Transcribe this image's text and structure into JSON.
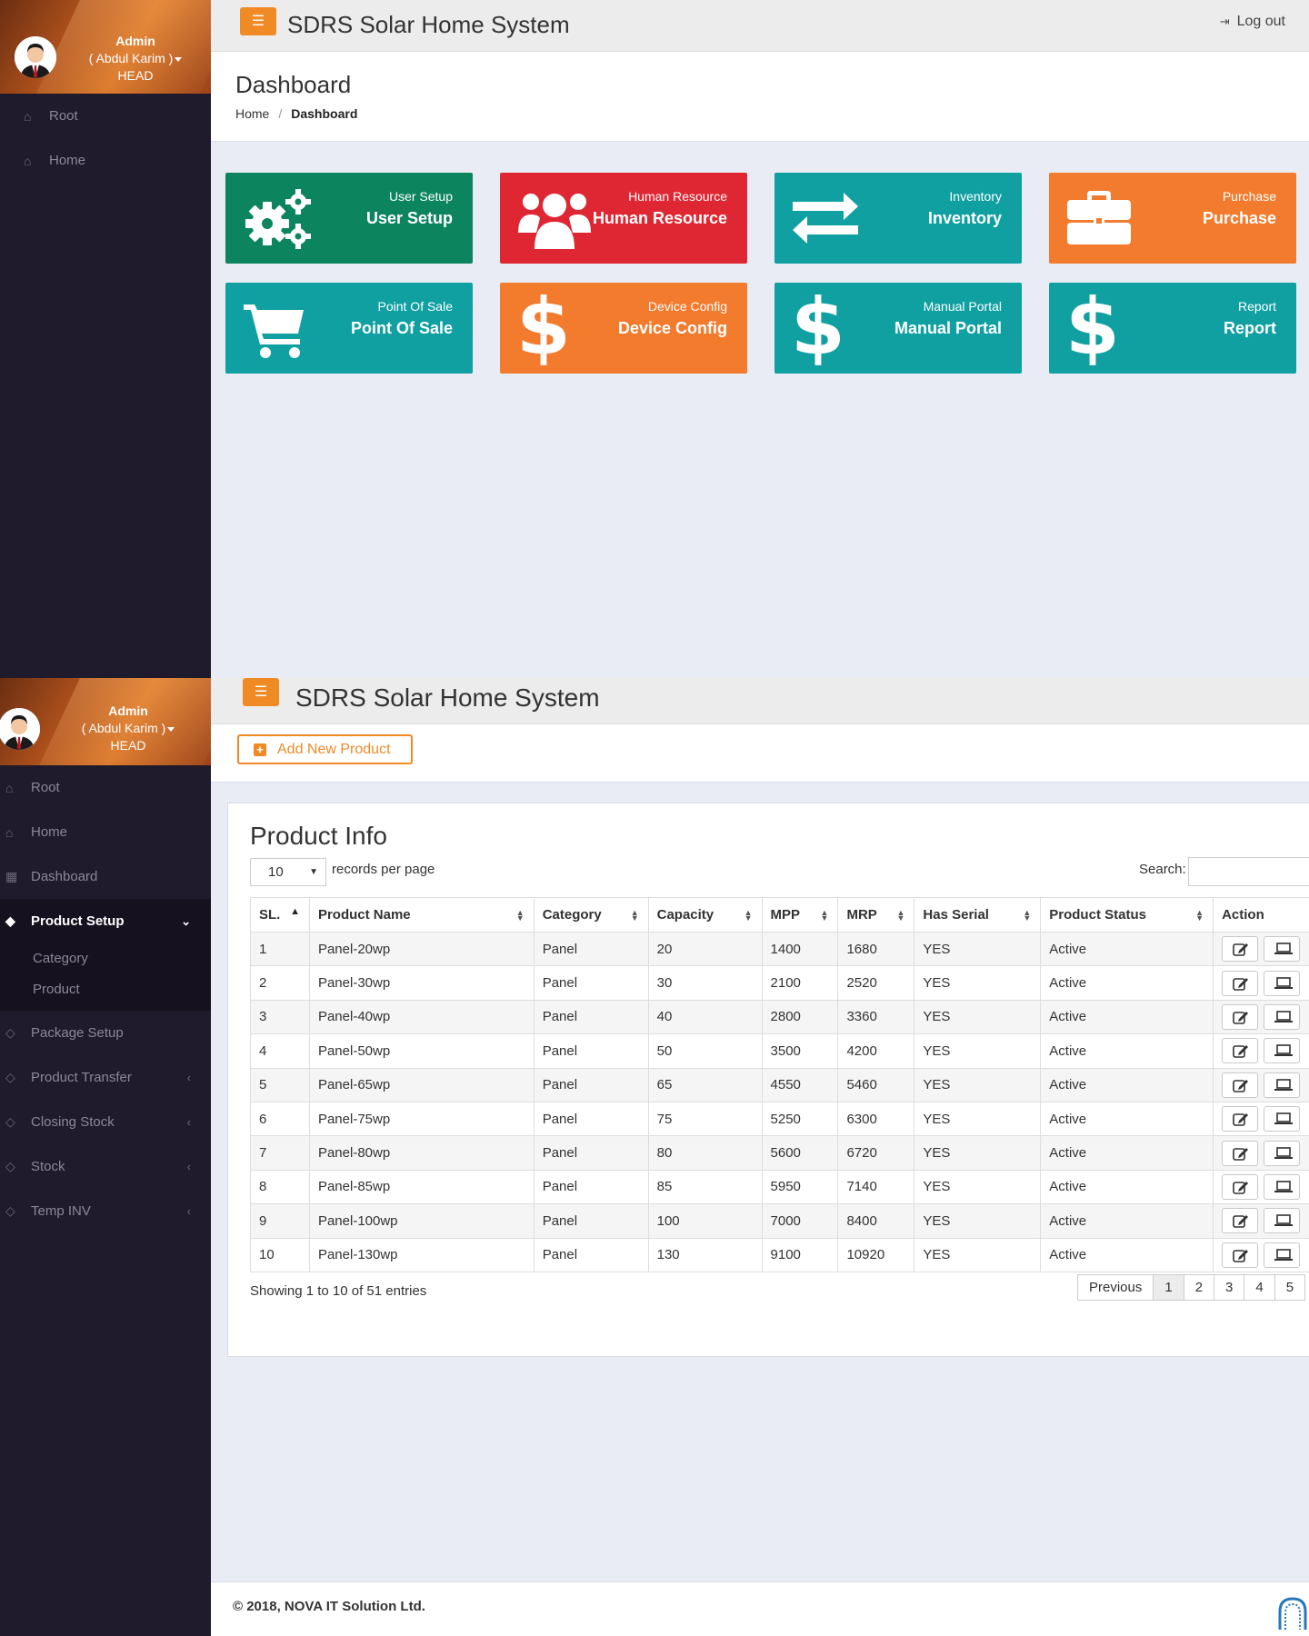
{
  "app_title": "SDRS Solar Home System",
  "profile": {
    "role": "Admin",
    "name": "( Abdul Karim )",
    "dept": "HEAD"
  },
  "logout_label": "Log out",
  "dashboard": {
    "title": "Dashboard",
    "breadcrumb": {
      "home": "Home",
      "current": "Dashboard"
    },
    "sidebar": [
      {
        "label": "Root",
        "icon": "home-icon"
      },
      {
        "label": "Home",
        "icon": "home-icon"
      }
    ],
    "tiles": [
      {
        "small": "User Setup",
        "large": "User Setup",
        "icon": "gears-icon",
        "color": "#0c855f"
      },
      {
        "small": "Human Resource",
        "large": "Human Resource",
        "icon": "users-icon",
        "color": "#df2633"
      },
      {
        "small": "Inventory",
        "large": "Inventory",
        "icon": "exchange-icon",
        "color": "#10a0a2"
      },
      {
        "small": "Purchase",
        "large": "Purchase",
        "icon": "briefcase-icon",
        "color": "#f27b2e"
      },
      {
        "small": "Point Of Sale",
        "large": "Point Of Sale",
        "icon": "cart-icon",
        "color": "#10a0a2"
      },
      {
        "small": "Device Config",
        "large": "Device Config",
        "icon": "dollar-icon",
        "color": "#f27b2e"
      },
      {
        "small": "Manual Portal",
        "large": "Manual Portal",
        "icon": "dollar-icon",
        "color": "#10a0a2"
      },
      {
        "small": "Report",
        "large": "Report",
        "icon": "dollar-icon",
        "color": "#10a0a2"
      }
    ]
  },
  "product_page": {
    "sidebar": {
      "root": "Root",
      "home": "Home",
      "dashboard": "Dashboard",
      "product_setup": "Product Setup",
      "sub": [
        "Category",
        "Product"
      ],
      "package_setup": "Package Setup",
      "product_transfer": "Product Transfer",
      "closing_stock": "Closing Stock",
      "stock": "Stock",
      "temp_inv": "Temp INV"
    },
    "add_button": "Add New Product",
    "panel_title": "Product Info",
    "length_value": "10",
    "length_text": "records per page",
    "search_label": "Search:",
    "columns": [
      "SL.",
      "Product Name",
      "Category",
      "Capacity",
      "MPP",
      "MRP",
      "Has Serial",
      "Product Status",
      "Action"
    ],
    "rows": [
      {
        "sl": "1",
        "name": "Panel-20wp",
        "category": "Panel",
        "capacity": "20",
        "mpp": "1400",
        "mrp": "1680",
        "serial": "YES",
        "status": "Active"
      },
      {
        "sl": "2",
        "name": "Panel-30wp",
        "category": "Panel",
        "capacity": "30",
        "mpp": "2100",
        "mrp": "2520",
        "serial": "YES",
        "status": "Active"
      },
      {
        "sl": "3",
        "name": "Panel-40wp",
        "category": "Panel",
        "capacity": "40",
        "mpp": "2800",
        "mrp": "3360",
        "serial": "YES",
        "status": "Active"
      },
      {
        "sl": "4",
        "name": "Panel-50wp",
        "category": "Panel",
        "capacity": "50",
        "mpp": "3500",
        "mrp": "4200",
        "serial": "YES",
        "status": "Active"
      },
      {
        "sl": "5",
        "name": "Panel-65wp",
        "category": "Panel",
        "capacity": "65",
        "mpp": "4550",
        "mrp": "5460",
        "serial": "YES",
        "status": "Active"
      },
      {
        "sl": "6",
        "name": "Panel-75wp",
        "category": "Panel",
        "capacity": "75",
        "mpp": "5250",
        "mrp": "6300",
        "serial": "YES",
        "status": "Active"
      },
      {
        "sl": "7",
        "name": "Panel-80wp",
        "category": "Panel",
        "capacity": "80",
        "mpp": "5600",
        "mrp": "6720",
        "serial": "YES",
        "status": "Active"
      },
      {
        "sl": "8",
        "name": "Panel-85wp",
        "category": "Panel",
        "capacity": "85",
        "mpp": "5950",
        "mrp": "7140",
        "serial": "YES",
        "status": "Active"
      },
      {
        "sl": "9",
        "name": "Panel-100wp",
        "category": "Panel",
        "capacity": "100",
        "mpp": "7000",
        "mrp": "8400",
        "serial": "YES",
        "status": "Active"
      },
      {
        "sl": "10",
        "name": "Panel-130wp",
        "category": "Panel",
        "capacity": "130",
        "mpp": "9100",
        "mrp": "10920",
        "serial": "YES",
        "status": "Active"
      }
    ],
    "info": "Showing 1 to 10 of 51 entries",
    "pager": {
      "previous": "Previous",
      "pages": [
        "1",
        "2",
        "3",
        "4",
        "5"
      ]
    },
    "footer": "© 2018, NOVA IT Solution Ltd."
  }
}
